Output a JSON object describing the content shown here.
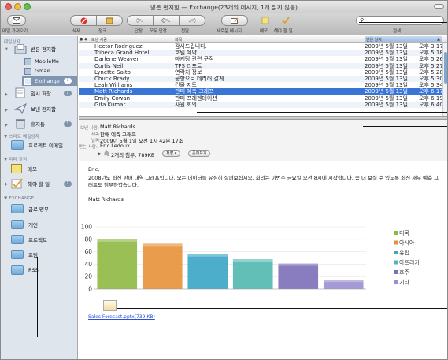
{
  "window": {
    "title": "받은 편지함 — Exchange(23개의 메시지, 1개 읽지 않음)"
  },
  "toolbar": {
    "left_label": "메일 가져오기",
    "buttons": [
      {
        "icon": "delete-icon",
        "label": "삭제"
      },
      {
        "icon": "junk-icon",
        "label": "정크"
      },
      {
        "icon": "reply-icon",
        "label": "답장"
      },
      {
        "icon": "reply-all-icon",
        "label": "모두 답장"
      },
      {
        "icon": "forward-icon",
        "label": "전달"
      },
      {
        "icon": "new-message-icon",
        "label": "새로운 메시지"
      },
      {
        "icon": "note-icon",
        "label": "메모"
      },
      {
        "icon": "todo-icon",
        "label": "해야 할 일"
      }
    ],
    "search_label": "검색",
    "search_value": ""
  },
  "sidebar": {
    "sections": {
      "mailbox": "메일상자",
      "smart": "▼ 스마트 메일상자",
      "reminders": "▼ 미리 알림",
      "exchange": "▼ EXCHANGE"
    },
    "items": [
      {
        "label": "받은 편지함"
      },
      {
        "label": "MobileMe"
      },
      {
        "label": "Gmail"
      },
      {
        "label": "Exchange",
        "badge": "1"
      },
      {
        "label": "임시 저장",
        "badge": "1"
      },
      {
        "label": "보낸 편지함"
      },
      {
        "label": "휴지통",
        "badge": "1"
      },
      {
        "label": "프로젝트 이메일"
      },
      {
        "label": "메모"
      },
      {
        "label": "해야 할 일",
        "badge": "1"
      },
      {
        "label": "급료 명부"
      },
      {
        "label": "개인"
      },
      {
        "label": "프로젝트"
      },
      {
        "label": "포럼"
      },
      {
        "label": "RSS"
      }
    ]
  },
  "message_list": {
    "columns": {
      "from": "보낸 사람",
      "subject": "제목",
      "date": "받은 날짜"
    },
    "rows": [
      {
        "from": "Hector Rodriguez",
        "subject": "감사드립니다.",
        "date": "2009년 5월 13일",
        "time": "오후 3:17"
      },
      {
        "from": "Tribeca Grand Hotel",
        "subject": "호텔 예약",
        "date": "2009년 5월 13일",
        "time": "오후 5:18"
      },
      {
        "from": "Darlene Weaver",
        "subject": "마케팅 관련 구직",
        "date": "2009년 5월 13일",
        "time": "오후 5:26"
      },
      {
        "from": "Curtis Neil",
        "subject": "TPS 리포트",
        "date": "2009년 5월 13일",
        "time": "오후 5:27"
      },
      {
        "from": "Lynette Saito",
        "subject": "연락처 정보",
        "date": "2009년 5월 13일",
        "time": "오후 5:28"
      },
      {
        "from": "Chuck Brady",
        "subject": "공항으로 데리러 갈게.",
        "date": "2009년 5월 13일",
        "time": "오후 5:30"
      },
      {
        "from": "Leah Williams",
        "subject": "건물 지도",
        "date": "2009년 5월 13일",
        "time": "오후 5:34"
      },
      {
        "from": "Matt Richards",
        "subject": "판매 예측 그래프",
        "date": "2009년 5월 13일",
        "time": "오후 6:17",
        "selected": true
      },
      {
        "from": "Emily Cowan",
        "subject": "판매 프레젠테이션",
        "date": "2009년 5월 13일",
        "time": "오후 6:19"
      },
      {
        "from": "Gita Kumar",
        "subject": "사원 회의",
        "date": "2009년 5월 13일",
        "time": "오후 6:40"
      }
    ]
  },
  "message_header": {
    "from_label": "보낸 사람:",
    "from": "Matt Richards",
    "subject_label": "제목:",
    "subject": "판매 예측 그래프",
    "date_label": "날짜:",
    "date": "2009년 5월 1일 오전 1시 42분 17초",
    "to_label": "받는 사람:",
    "to": "Eric Ledoux",
    "attachments": "2개의 첨부, 789KB",
    "save_button": "저장 ▾",
    "quicklook_button": "훑어보기"
  },
  "message_body": {
    "greeting": "Eric,",
    "paragraph": "2008년도 최신 판매 내역 그래프입니다. 모든 데이터를 유심히 살펴보십시오. 회의는 이번주 금요일 오전 8시에 시작합니다. 좀 더 보실 수 있도록 최신 재무 예측 그래프도 첨부하였습니다.",
    "signature": "Matt Richards",
    "attachment_name": "Sales Forecast.pptx(739 KB)"
  },
  "colors": {
    "selected_row": "#3875d7",
    "sidebar_bg": "#dfe5ed",
    "badge": "#7f94ac",
    "link": "#2c4fd8"
  },
  "chart_data": {
    "type": "bar",
    "categories": [
      "미국",
      "아시아",
      "유럽",
      "아프리카",
      "호주",
      "기타"
    ],
    "values": [
      80,
      73,
      56,
      48,
      41,
      15
    ],
    "colors": [
      "#8eb842",
      "#e69138",
      "#3aa5c7",
      "#50b8b0",
      "#7c6fb8",
      "#9b8fd0"
    ],
    "yticks": [
      0,
      20,
      40,
      60,
      80,
      100
    ],
    "ylim": [
      0,
      100
    ],
    "legend_position": "right",
    "grid": true
  }
}
